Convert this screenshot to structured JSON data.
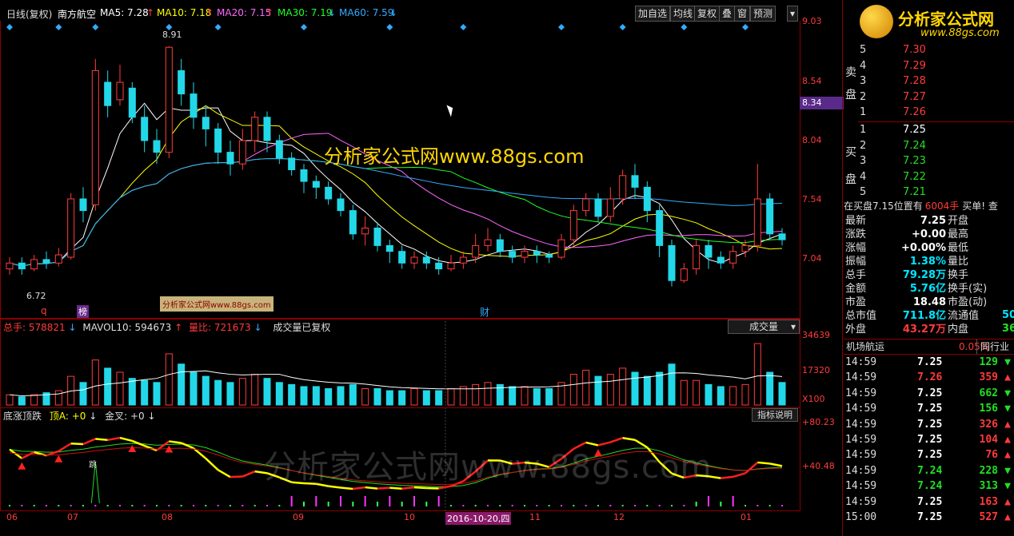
{
  "top_bar": {
    "chart_title": "日线(复权)",
    "stock_name": "南方航空",
    "ma5": "MA5: 7.28",
    "ma10": "MA10: 7.18",
    "ma20": "MA20: 7.15",
    "ma30": "MA30: 7.19",
    "ma60": "MA60: 7.59",
    "buttons": [
      "加自选",
      "均线",
      "复权",
      "叠",
      "窗",
      "预测"
    ]
  },
  "price_scale": [
    "9.03",
    "8.54",
    "8.04",
    "7.54",
    "7.04"
  ],
  "current_price_tag": "8.34",
  "annotations": {
    "high": "8.91",
    "low": "6.72",
    "mark_q": "q",
    "mark_bang": "榜",
    "mark_cai": "财",
    "watermark_center": "分析家公式网www.88gs.com",
    "watermark_box": "分析家公式网www.88gs.com",
    "watermark_bottom": "分析家公式网www.88gs.com",
    "tiao": "跳"
  },
  "volume_panel": {
    "total": "总手: 578821",
    "mavol": "MAVOL10: 594673",
    "ratio": "量比: 721673",
    "note": "成交量已复权",
    "dropdown": "成交量",
    "scale": [
      "34639",
      "17320",
      "X100"
    ]
  },
  "indicator_panel": {
    "name": "底涨顶跌",
    "a": "顶A: +0",
    "b": "金叉: +0",
    "help": "指标说明",
    "scale": [
      "+80.23",
      "+40.48"
    ]
  },
  "x_axis": {
    "labels": [
      "06",
      "07",
      "08",
      "09",
      "10",
      "11",
      "12",
      "01"
    ],
    "cursor_date": "2016-10-20,四"
  },
  "logo": {
    "name": "分析家公式网",
    "url": "www.88gs.com"
  },
  "order_book": {
    "sell_labels": [
      "卖",
      "盘"
    ],
    "buy_labels": [
      "买",
      "盘"
    ],
    "sell": [
      {
        "level": "5",
        "price": "7.30"
      },
      {
        "level": "4",
        "price": "7.29"
      },
      {
        "level": "3",
        "price": "7.28"
      },
      {
        "level": "2",
        "price": "7.27"
      },
      {
        "level": "1",
        "price": "7.26"
      }
    ],
    "buy": [
      {
        "level": "1",
        "price": "7.25"
      },
      {
        "level": "2",
        "price": "7.24"
      },
      {
        "level": "3",
        "price": "7.23"
      },
      {
        "level": "4",
        "price": "7.22"
      },
      {
        "level": "5",
        "price": "7.21"
      }
    ],
    "status_left": "在买盘7.15位置有",
    "status_vol": "6004手",
    "status_right": "买单! 查"
  },
  "quote": [
    {
      "l": "最新",
      "v": "7.25",
      "l2": "开盘",
      "vc": "white"
    },
    {
      "l": "涨跌",
      "v": "+0.00",
      "l2": "最高",
      "vc": "white"
    },
    {
      "l": "涨幅",
      "v": "+0.00%",
      "l2": "最低",
      "vc": "white"
    },
    {
      "l": "振幅",
      "v": "1.38%",
      "l2": "量比",
      "vc": "cyan"
    },
    {
      "l": "总手",
      "v": "79.28万",
      "l2": "换手",
      "vc": "cyan"
    },
    {
      "l": "金额",
      "v": "5.76亿",
      "l2": "换手(实)",
      "vc": "cyan"
    },
    {
      "l": "市盈",
      "v": "18.48",
      "l2": "市盈(动)",
      "vc": "white"
    },
    {
      "l": "总市值",
      "v": "711.8亿",
      "l2": "流通值",
      "vc": "cyan"
    },
    {
      "l": "外盘",
      "v": "43.27万",
      "l2": "内盘",
      "vc": "red"
    }
  ],
  "quote_cut": [
    "50",
    "36"
  ],
  "sector": {
    "name": "机场航运",
    "change": "0.05%",
    "btn": "同行业"
  },
  "ticks": [
    {
      "t": "14:59",
      "p": "7.25",
      "v": "129",
      "d": "down"
    },
    {
      "t": "14:59",
      "p": "7.26",
      "v": "359",
      "d": "up"
    },
    {
      "t": "14:59",
      "p": "7.25",
      "v": "662",
      "d": "down"
    },
    {
      "t": "14:59",
      "p": "7.25",
      "v": "156",
      "d": "down"
    },
    {
      "t": "14:59",
      "p": "7.25",
      "v": "326",
      "d": "up"
    },
    {
      "t": "14:59",
      "p": "7.25",
      "v": "104",
      "d": "up"
    },
    {
      "t": "14:59",
      "p": "7.25",
      "v": "76",
      "d": "up"
    },
    {
      "t": "14:59",
      "p": "7.24",
      "v": "228",
      "d": "down"
    },
    {
      "t": "14:59",
      "p": "7.24",
      "v": "313",
      "d": "down"
    },
    {
      "t": "14:59",
      "p": "7.25",
      "v": "163",
      "d": "up"
    },
    {
      "t": "15:00",
      "p": "7.25",
      "v": "527",
      "d": "up"
    }
  ],
  "chart_data": {
    "type": "candlestick",
    "ylim": [
      6.6,
      9.1
    ],
    "candles": [
      [
        7.0,
        7.05,
        6.95,
        7.1
      ],
      [
        7.05,
        7.0,
        6.95,
        7.1
      ],
      [
        7.0,
        7.08,
        6.98,
        7.12
      ],
      [
        7.08,
        7.05,
        7.0,
        7.15
      ],
      [
        7.05,
        7.12,
        7.02,
        7.18
      ],
      [
        7.1,
        7.6,
        7.08,
        7.65
      ],
      [
        7.6,
        7.5,
        7.4,
        7.7
      ],
      [
        7.55,
        8.7,
        7.5,
        8.8
      ],
      [
        8.6,
        8.4,
        8.3,
        8.7
      ],
      [
        8.45,
        8.6,
        8.4,
        8.75
      ],
      [
        8.55,
        8.3,
        8.25,
        8.6
      ],
      [
        8.3,
        8.1,
        8.0,
        8.4
      ],
      [
        8.1,
        8.0,
        7.9,
        8.2
      ],
      [
        8.0,
        8.9,
        7.95,
        8.91
      ],
      [
        8.7,
        8.5,
        8.4,
        8.8
      ],
      [
        8.5,
        8.3,
        8.2,
        8.6
      ],
      [
        8.3,
        8.2,
        8.05,
        8.4
      ],
      [
        8.2,
        8.0,
        7.9,
        8.25
      ],
      [
        8.0,
        7.9,
        7.8,
        8.1
      ],
      [
        7.9,
        8.1,
        7.85,
        8.2
      ],
      [
        8.1,
        8.3,
        8.0,
        8.35
      ],
      [
        8.3,
        8.1,
        8.0,
        8.35
      ],
      [
        8.1,
        7.95,
        7.9,
        8.15
      ],
      [
        7.95,
        7.85,
        7.8,
        8.0
      ],
      [
        7.85,
        7.75,
        7.65,
        7.9
      ],
      [
        7.75,
        7.7,
        7.6,
        7.8
      ],
      [
        7.7,
        7.6,
        7.55,
        7.75
      ],
      [
        7.6,
        7.5,
        7.45,
        7.65
      ],
      [
        7.5,
        7.3,
        7.25,
        7.55
      ],
      [
        7.3,
        7.35,
        7.2,
        7.45
      ],
      [
        7.35,
        7.2,
        7.15,
        7.4
      ],
      [
        7.2,
        7.15,
        7.05,
        7.25
      ],
      [
        7.15,
        7.05,
        7.0,
        7.2
      ],
      [
        7.05,
        7.1,
        7.0,
        7.15
      ],
      [
        7.1,
        7.05,
        7.0,
        7.15
      ],
      [
        7.05,
        7.0,
        6.95,
        7.1
      ],
      [
        7.0,
        7.05,
        6.98,
        7.12
      ],
      [
        7.05,
        7.1,
        7.0,
        7.15
      ],
      [
        7.1,
        7.2,
        7.05,
        7.3
      ],
      [
        7.2,
        7.25,
        7.15,
        7.35
      ],
      [
        7.25,
        7.15,
        7.1,
        7.3
      ],
      [
        7.15,
        7.1,
        7.05,
        7.2
      ],
      [
        7.1,
        7.15,
        7.05,
        7.2
      ],
      [
        7.15,
        7.12,
        7.05,
        7.2
      ],
      [
        7.12,
        7.1,
        7.05,
        7.15
      ],
      [
        7.1,
        7.25,
        7.08,
        7.3
      ],
      [
        7.25,
        7.5,
        7.2,
        7.55
      ],
      [
        7.5,
        7.6,
        7.45,
        7.65
      ],
      [
        7.6,
        7.45,
        7.4,
        7.65
      ],
      [
        7.45,
        7.6,
        7.4,
        7.7
      ],
      [
        7.6,
        7.8,
        7.55,
        7.85
      ],
      [
        7.8,
        7.7,
        7.6,
        7.9
      ],
      [
        7.7,
        7.5,
        7.4,
        7.75
      ],
      [
        7.5,
        7.2,
        7.1,
        7.55
      ],
      [
        7.2,
        6.9,
        6.85,
        7.25
      ],
      [
        6.9,
        7.0,
        6.88,
        7.05
      ],
      [
        7.0,
        7.2,
        6.95,
        7.25
      ],
      [
        7.2,
        7.1,
        7.0,
        7.25
      ],
      [
        7.1,
        7.05,
        7.0,
        7.15
      ],
      [
        7.05,
        7.15,
        7.0,
        7.2
      ],
      [
        7.15,
        7.2,
        7.1,
        7.25
      ],
      [
        7.2,
        7.6,
        7.15,
        7.9
      ],
      [
        7.6,
        7.3,
        7.25,
        7.65
      ],
      [
        7.3,
        7.25,
        7.2,
        7.35
      ]
    ],
    "volume": [
      5,
      4,
      5,
      6,
      7,
      14,
      11,
      22,
      18,
      16,
      13,
      12,
      11,
      25,
      20,
      16,
      14,
      12,
      11,
      13,
      15,
      13,
      11,
      10,
      9,
      9,
      8,
      9,
      10,
      8,
      8,
      7,
      7,
      8,
      7,
      7,
      8,
      9,
      10,
      11,
      10,
      9,
      9,
      8,
      8,
      11,
      15,
      17,
      14,
      15,
      18,
      16,
      14,
      16,
      20,
      12,
      12,
      10,
      9,
      9,
      10,
      30,
      16,
      11
    ]
  }
}
